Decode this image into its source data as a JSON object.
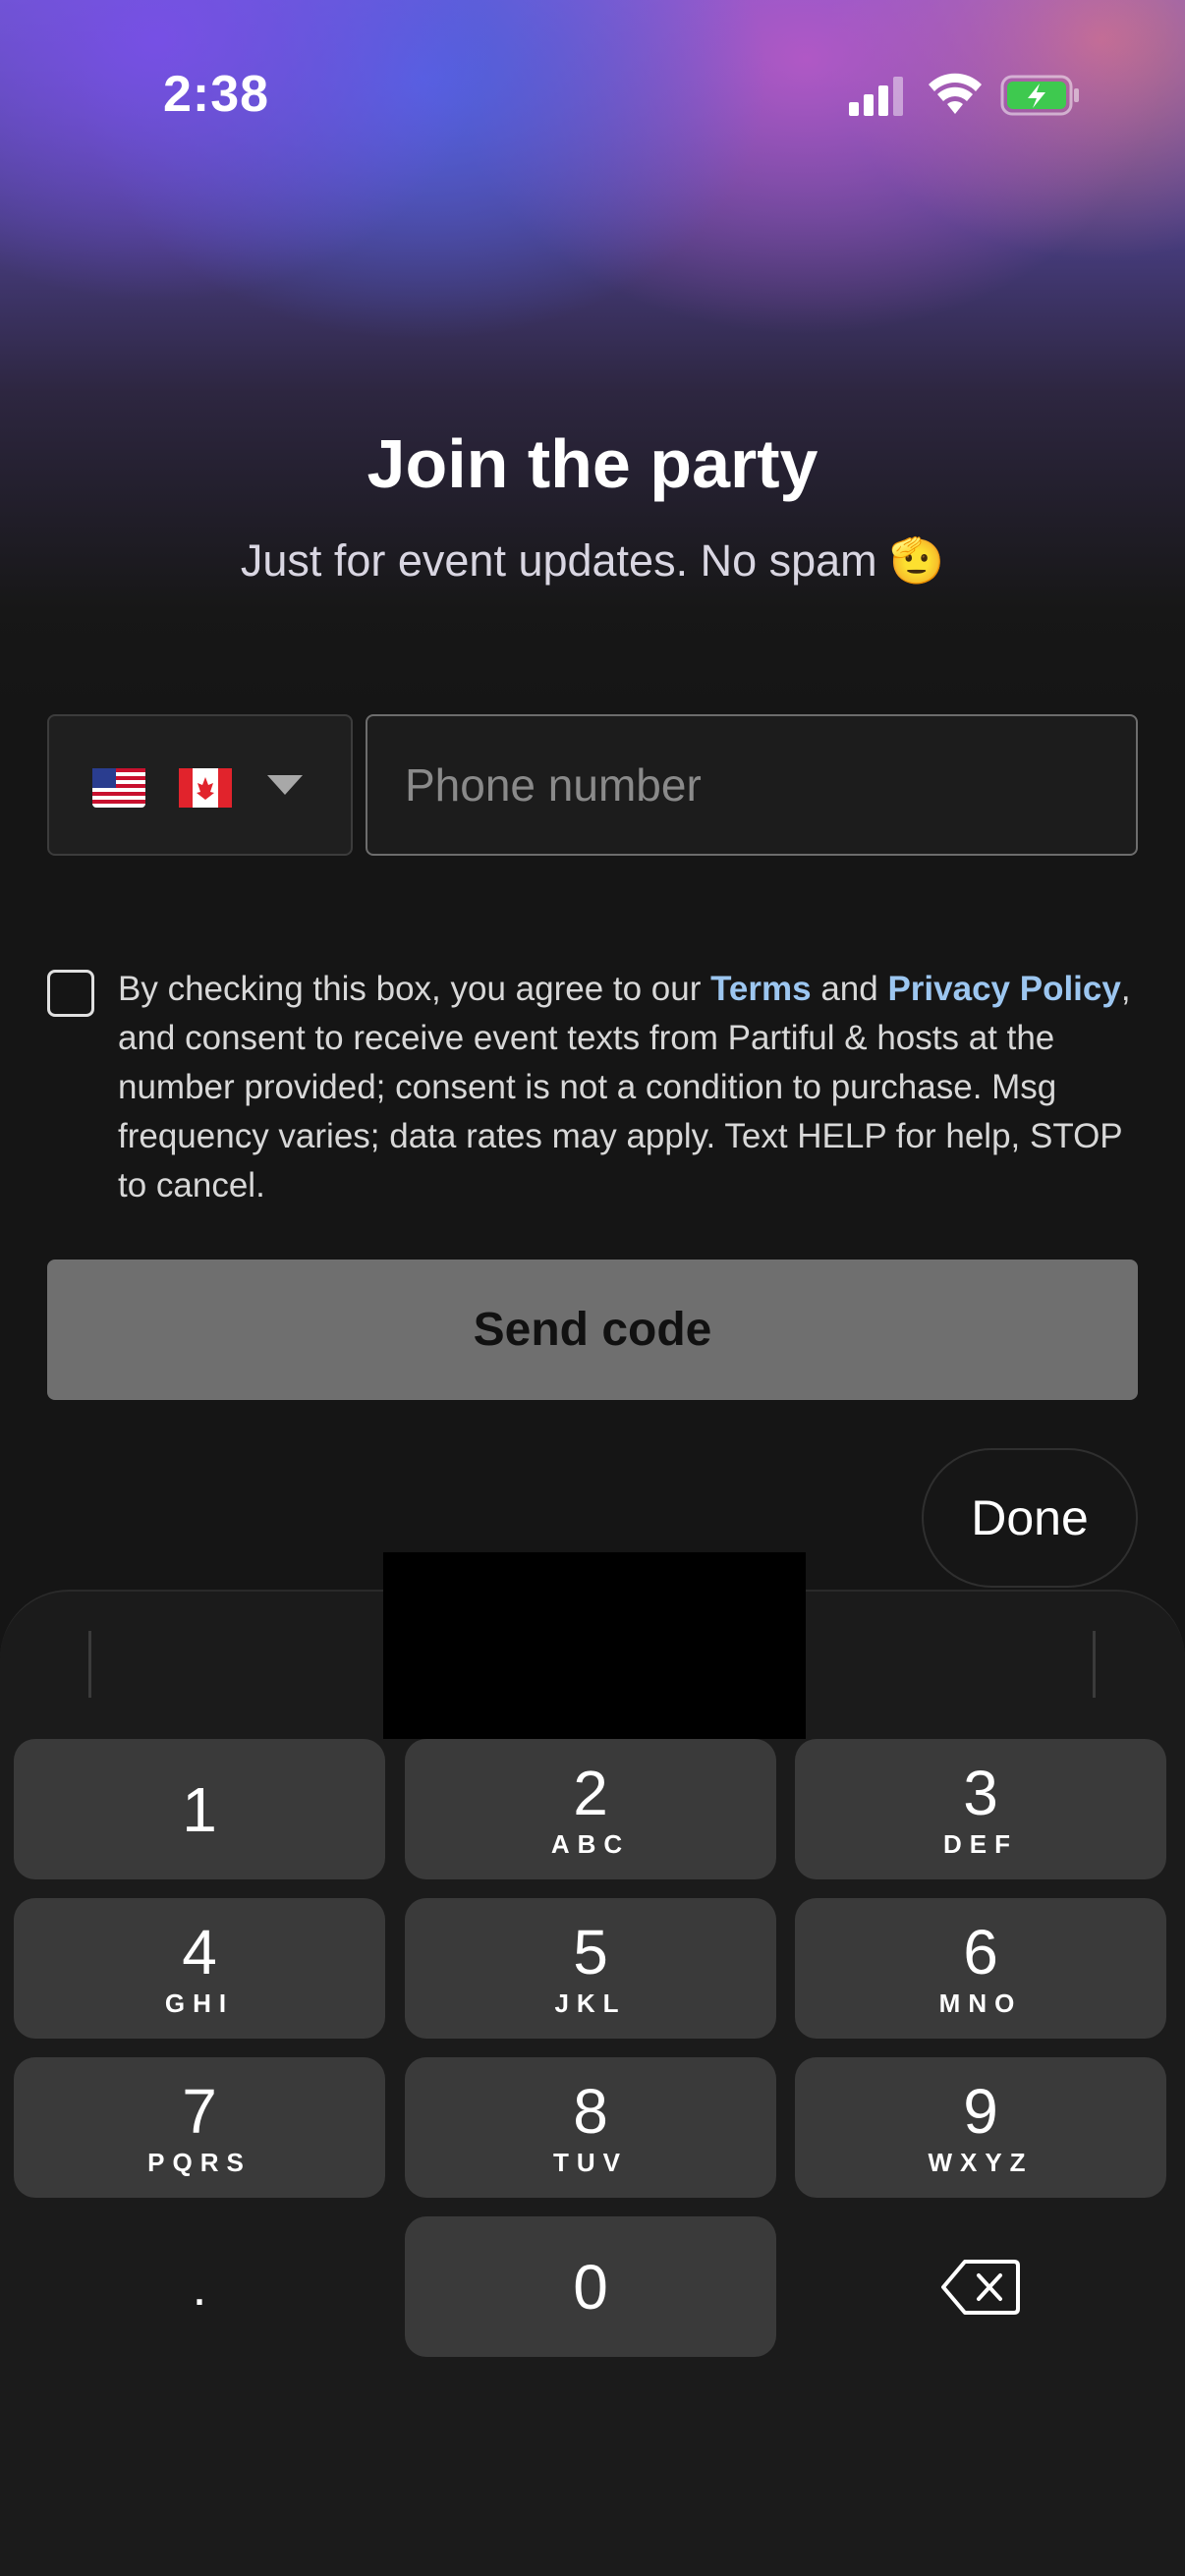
{
  "status_bar": {
    "time": "2:38",
    "icons": [
      "signal-icon",
      "wifi-icon",
      "battery-charging-icon"
    ]
  },
  "header": {
    "title": "Join the party",
    "subtitle": "Just for event updates. No spam 🫡"
  },
  "phone_form": {
    "country_flags": [
      "us-flag-icon",
      "canada-flag-icon"
    ],
    "phone_placeholder": "Phone number",
    "phone_value": ""
  },
  "consent": {
    "prefix": "By checking this box, you agree to our ",
    "terms_link": "Terms",
    "and": " and ",
    "privacy_link": "Privacy Policy",
    "suffix": ", and consent to receive event texts from Partiful & hosts at the number provided; consent is not a condition to purchase. Msg frequency varies; data rates may apply. Text HELP for help, STOP to cancel.",
    "checked": false
  },
  "buttons": {
    "send_code": "Send code",
    "done": "Done"
  },
  "keypad": {
    "keys": [
      {
        "digit": "1",
        "letters": ""
      },
      {
        "digit": "2",
        "letters": "ABC"
      },
      {
        "digit": "3",
        "letters": "DEF"
      },
      {
        "digit": "4",
        "letters": "GHI"
      },
      {
        "digit": "5",
        "letters": "JKL"
      },
      {
        "digit": "6",
        "letters": "MNO"
      },
      {
        "digit": "7",
        "letters": "PQRS"
      },
      {
        "digit": "8",
        "letters": "TUV"
      },
      {
        "digit": "9",
        "letters": "WXYZ"
      },
      {
        "digit": ".",
        "letters": ""
      },
      {
        "digit": "0",
        "letters": ""
      }
    ],
    "backspace_icon": "backspace-icon"
  },
  "colors": {
    "background": "#151515",
    "link": "#9cc6f0",
    "button_disabled": "#6f6f6f",
    "key": "#3a3a3a"
  }
}
